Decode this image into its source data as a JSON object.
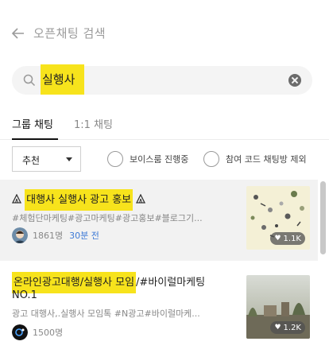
{
  "header": {
    "title": "오픈채팅 검색"
  },
  "search": {
    "query": "실행사"
  },
  "tabs": [
    {
      "label": "그룹 채팅",
      "active": true
    },
    {
      "label": "1:1 채팅",
      "active": false
    }
  ],
  "filters": {
    "sort_value": "추천",
    "options": [
      "보이스룸 진행중",
      "참여 코드 채팅방 제외"
    ]
  },
  "results": [
    {
      "name_highlight": "대행사 실행사 광고 홍보",
      "name_rest": "",
      "tags": "#체험단마케팅#광고마케팅#광고홍보#블로그기...",
      "members": "1861명",
      "time": "30분 전",
      "likes": "1.1K"
    },
    {
      "name_highlight": "온라인광고대행/실행사 모임",
      "name_rest": "/#바이럴마케팅",
      "name_line2": "NO.1",
      "desc": "광고 대행사,.실행사 모임톡 #N광고#바이럴마케...",
      "members": "1500명",
      "likes": "1.2K"
    }
  ],
  "colors": {
    "highlight": "#f7e31c",
    "link": "#3d7ad6"
  }
}
